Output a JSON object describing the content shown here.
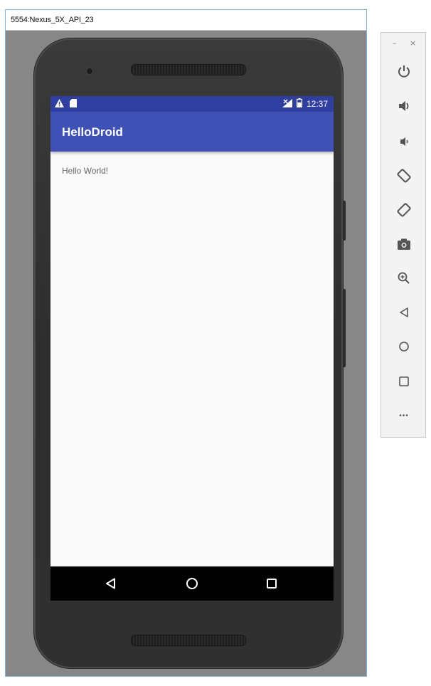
{
  "window": {
    "title": "5554:Nexus_5X_API_23"
  },
  "statusbar": {
    "time": "12:37"
  },
  "app": {
    "title": "HelloDroid",
    "content_text": "Hello World!"
  },
  "navbar": {
    "buttons": [
      "back-icon",
      "home-icon",
      "recents-icon"
    ]
  },
  "toolbar": {
    "minimize_label": "–",
    "close_label": "×",
    "more_label": "•••",
    "buttons": [
      "power-icon",
      "volume-up-icon",
      "volume-down-icon",
      "rotate-left-icon",
      "rotate-right-icon",
      "camera-icon",
      "zoom-icon",
      "back-icon",
      "home-icon",
      "overview-icon",
      "more-icon"
    ]
  },
  "colors": {
    "statusbar": "#303f9f",
    "appbar": "#3f51b5",
    "toolbar_icon": "#555555"
  }
}
